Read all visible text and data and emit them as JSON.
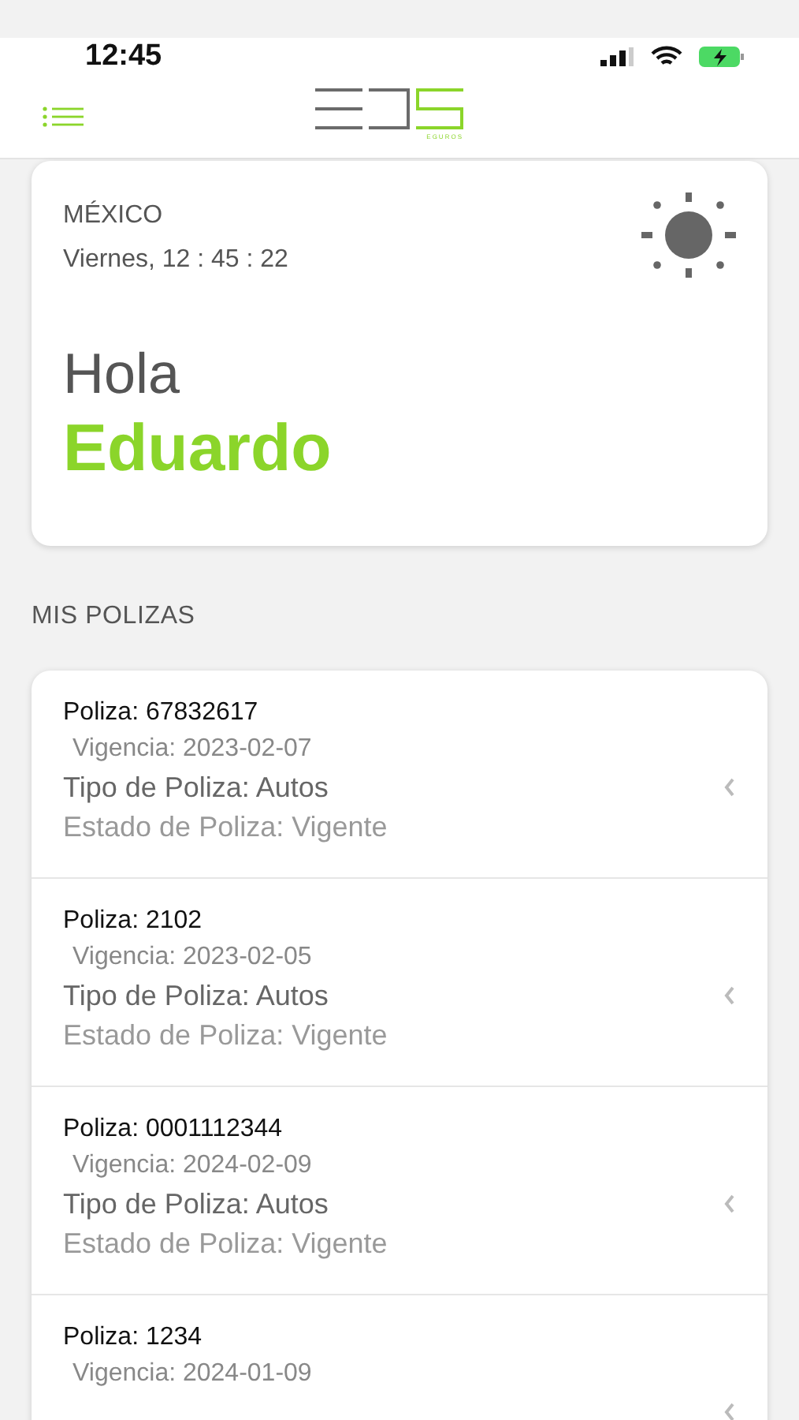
{
  "status_bar": {
    "time": "12:45"
  },
  "header": {
    "logo_subtitle": "EGUROS"
  },
  "greeting_card": {
    "country": "MÉXICO",
    "datetime": "Viernes, 12 : 45 : 22",
    "greeting": "Hola",
    "name": "Eduardo"
  },
  "section_title": "MIS POLIZAS",
  "policies": [
    {
      "number": "Poliza: 67832617",
      "validity": "Vigencia: 2023-02-07",
      "type": "Tipo de Poliza: Autos",
      "status": "Estado de Poliza: Vigente"
    },
    {
      "number": "Poliza: 2102",
      "validity": "Vigencia: 2023-02-05",
      "type": "Tipo de Poliza: Autos",
      "status": "Estado de Poliza: Vigente"
    },
    {
      "number": "Poliza: 0001112344",
      "validity": "Vigencia: 2024-02-09",
      "type": "Tipo de Poliza: Autos",
      "status": "Estado de Poliza: Vigente"
    },
    {
      "number": "Poliza: 1234",
      "validity": "Vigencia: 2024-01-09"
    }
  ]
}
